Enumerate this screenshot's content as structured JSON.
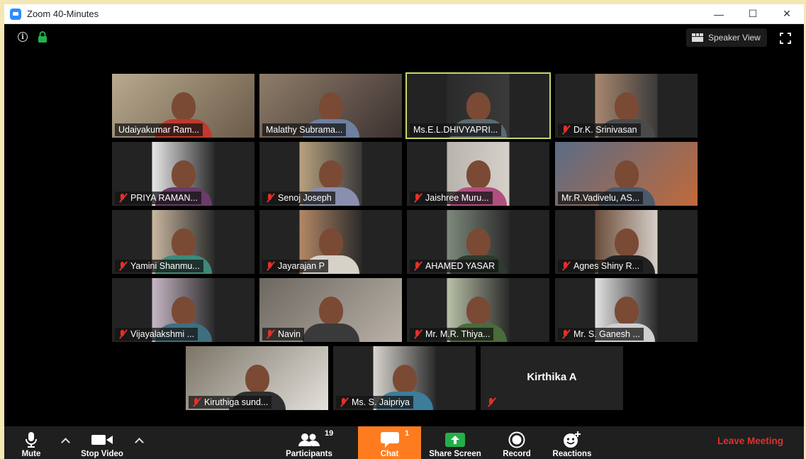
{
  "window": {
    "title": "Zoom 40-Minutes",
    "controls": [
      "—",
      "☐",
      "✕"
    ]
  },
  "topbar": {
    "speaker_view_label": "Speaker View"
  },
  "participants": [
    {
      "name": "Udaiyakumar Ram...",
      "muted": false,
      "active": false
    },
    {
      "name": "Malathy Subrama...",
      "muted": false,
      "active": false
    },
    {
      "name": "Ms.E.L.DHIVYAPRI...",
      "muted": false,
      "active": true
    },
    {
      "name": "Dr.K. Srinivasan",
      "muted": true,
      "active": false
    },
    {
      "name": "PRIYA RAMAN...",
      "muted": true,
      "active": false
    },
    {
      "name": "Senoj Joseph",
      "muted": true,
      "active": false
    },
    {
      "name": "Jaishree Muru...",
      "muted": true,
      "active": false
    },
    {
      "name": "Mr.R.Vadivelu, AS...",
      "muted": false,
      "active": false
    },
    {
      "name": "Yamini Shanmu...",
      "muted": true,
      "active": false
    },
    {
      "name": "Jayarajan P",
      "muted": true,
      "active": false
    },
    {
      "name": "AHAMED YASAR",
      "muted": true,
      "active": false
    },
    {
      "name": "Agnes Shiny R...",
      "muted": true,
      "active": false
    },
    {
      "name": "Vijayalakshmi ...",
      "muted": true,
      "active": false
    },
    {
      "name": "Navin",
      "muted": true,
      "active": false
    },
    {
      "name": "Mr. M.R. Thiya...",
      "muted": true,
      "active": false
    },
    {
      "name": "Mr. S. Ganesh ...",
      "muted": true,
      "active": false
    },
    {
      "name": "Kiruthiga sund...",
      "muted": true,
      "active": false
    },
    {
      "name": "Ms. S. Jaipriya",
      "muted": true,
      "active": false
    },
    {
      "name": "Kirthika A",
      "muted": true,
      "active": false,
      "video_off": true
    }
  ],
  "toolbar": {
    "mute_label": "Mute",
    "stop_video_label": "Stop Video",
    "participants_label": "Participants",
    "participants_count": "19",
    "chat_label": "Chat",
    "chat_count": "1",
    "share_screen_label": "Share Screen",
    "record_label": "Record",
    "reactions_label": "Reactions",
    "leave_label": "Leave Meeting"
  },
  "colors": {
    "active_speaker_border": "#c8d56a",
    "chat_highlight": "#ff7c1e",
    "leave_red": "#e0312b",
    "share_green": "#23b04b",
    "mute_red": "#e0312b"
  }
}
